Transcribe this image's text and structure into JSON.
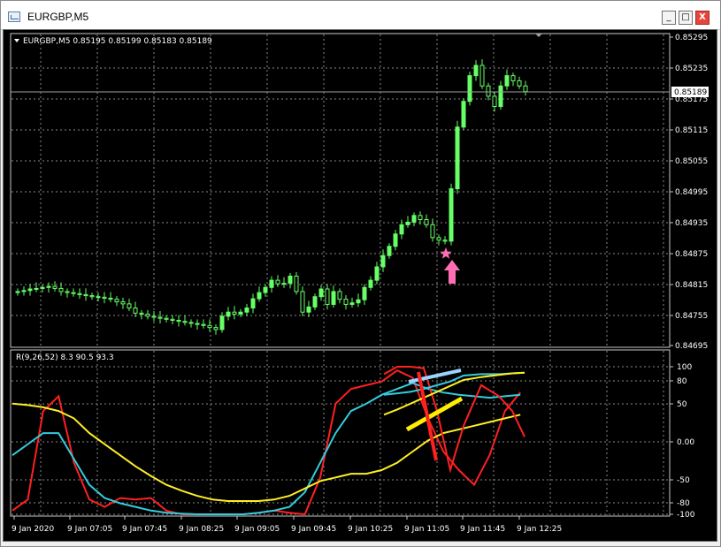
{
  "window": {
    "title": "EURGBP,M5",
    "buttons": {
      "minimize": "_",
      "maximize": "□",
      "close": "X"
    }
  },
  "main_chart": {
    "header": "EURGBP,M5  0.85195 0.85199 0.85183 0.85189",
    "price_axis": [
      "0.85295",
      "0.85235",
      "0.85175",
      "0.85115",
      "0.85055",
      "0.84995",
      "0.84935",
      "0.84875",
      "0.84815",
      "0.84755",
      "0.84695"
    ],
    "current_price": "0.85189",
    "bull_color": "#66ff66",
    "bear_color": "#000000",
    "grid_color": "#8a8a8a"
  },
  "indicator": {
    "header": "R(9,26,52) 8.3 90.5 93.3",
    "levels": [
      "100",
      "80",
      "50",
      "0.00",
      "-50",
      "-80",
      "-100"
    ],
    "series_colors": {
      "fast": "#ff2020",
      "medium": "#33ccdd",
      "slow": "#ffee22"
    }
  },
  "time_axis": [
    "9 Jan 2020",
    "9 Jan 07:05",
    "9 Jan 07:45",
    "9 Jan 08:25",
    "9 Jan 09:05",
    "9 Jan 09:45",
    "9 Jan 10:25",
    "9 Jan 11:05",
    "9 Jan 11:45",
    "9 Jan 12:25"
  ],
  "annotations": {
    "star_color": "#ff6eb4",
    "arrow_color": "#ff6eb4"
  }
}
